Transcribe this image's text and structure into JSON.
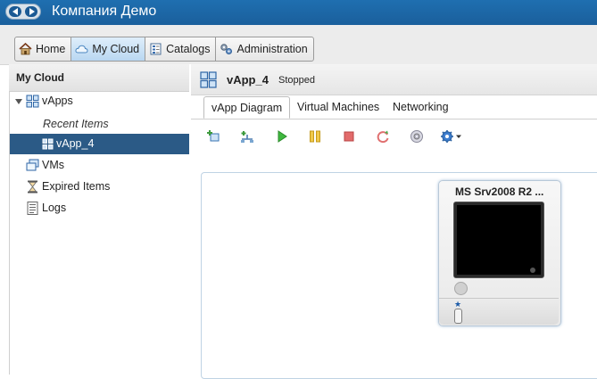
{
  "app": {
    "org_title": "Компания Демо"
  },
  "main_tabs": [
    {
      "label": "Home",
      "icon": "home-icon"
    },
    {
      "label": "My Cloud",
      "icon": "cloud-icon",
      "active": true
    },
    {
      "label": "Catalogs",
      "icon": "catalog-icon"
    },
    {
      "label": "Administration",
      "icon": "admin-gears-icon"
    }
  ],
  "sidebar": {
    "title": "My Cloud",
    "items": [
      {
        "label": "vApps",
        "icon": "vapps-icon",
        "expanded": true
      },
      {
        "label": "Recent Items"
      },
      {
        "label": "vApp_4",
        "icon": "vapp-icon",
        "selected": true
      },
      {
        "label": "VMs",
        "icon": "vms-icon"
      },
      {
        "label": "Expired Items",
        "icon": "hourglass-icon"
      },
      {
        "label": "Logs",
        "icon": "logs-icon"
      }
    ]
  },
  "vapp": {
    "name": "vApp_4",
    "status": "Stopped",
    "tabs": [
      {
        "label": "vApp Diagram",
        "active": true
      },
      {
        "label": "Virtual Machines"
      },
      {
        "label": "Networking"
      }
    ],
    "toolbar": [
      "add-vm-icon",
      "add-network-icon",
      "power-on-icon",
      "suspend-icon",
      "power-off-icon",
      "reset-icon",
      "insert-media-icon",
      "gear-icon"
    ]
  },
  "vm": {
    "name": "MS Srv2008 R2 ..."
  },
  "colors": {
    "header_blue": "#1f6fb0",
    "selection": "#2b5a86",
    "active_tab": "#c7e0f5"
  }
}
